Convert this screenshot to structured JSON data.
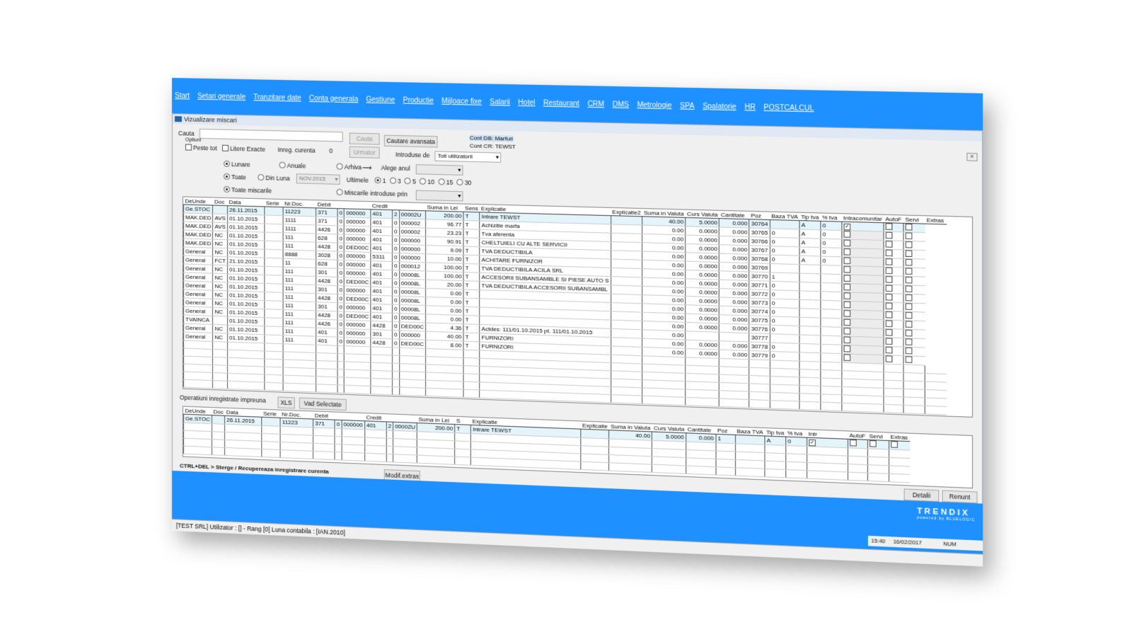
{
  "menu": [
    "Start",
    "Setari generale",
    "Tranzitare date",
    "Conta generala",
    "Gestiune",
    "Productie",
    "Mijloace fixe",
    "Salarii",
    "Hotel",
    "Restaurant",
    "CRM",
    "DMS",
    "Metrologie",
    "SPA",
    "Spalatorie",
    "HR",
    "POSTCALCUL"
  ],
  "window": {
    "title": "Vizualizare miscari"
  },
  "search": {
    "cauta_label": "Cauta",
    "cauta_btn": "Cauta",
    "advanced_btn": "Cautare avansata",
    "next_btn": "Urmator",
    "optiuni_label": "Optiuni",
    "peste_tot": "Peste tot",
    "litere_exacte": "Litere Exacte",
    "inreg_curenta_label": "Inreg. curenta",
    "inreg_curenta_value": "0",
    "introduse_de_label": "Introduse de",
    "introduse_de_value": "Toti utilizatorii",
    "cont_db": "Cont DB: Marfuri",
    "cont_cr": "Cont CR: TEWST"
  },
  "filters": {
    "lunare": "Lunare",
    "anuale": "Anuale",
    "arhiva": "Arhiva",
    "alege_anul": "Alege anul",
    "toate": "Toate",
    "din_luna": "Din Luna",
    "luna_value": "NOV.2015",
    "ultimele": "Ultimele",
    "ultimele_options": [
      "1",
      "3",
      "5",
      "10",
      "15",
      "30"
    ],
    "toate_miscarile": "Toate miscarile",
    "miscarile_introduse_prin": "Miscarile introduse prin"
  },
  "main_grid": {
    "columns": [
      "DeUnde",
      "Doc",
      "Data",
      "Serie",
      "Nr.Doc.",
      "Debit",
      "",
      "",
      "Credit",
      "",
      "",
      "Suma in Lei",
      "Sens",
      "Explicatie",
      "Explicatie2",
      "Suma in Valuta",
      "Curs Valuta",
      "Cantitate",
      "Poz",
      "Baza TVA",
      "Tip tva",
      "% tva",
      "Intracomunitar",
      "AutoF",
      "Servi",
      "Extras"
    ],
    "rows": [
      [
        "Ge.STOC",
        "",
        "26.11.2015",
        "",
        "11223",
        "371",
        "0",
        "000000",
        "401",
        "2",
        "00002U",
        "200.00",
        "T",
        "Intrare TEWST",
        "",
        "40.00",
        "5.0000",
        "0.000",
        "30764",
        "",
        "A",
        "0",
        "x",
        "",
        ""
      ],
      [
        "MAK.DED",
        "AVS",
        "01.10.2015",
        "",
        "1111",
        "371",
        "0",
        "000000",
        "401",
        "0",
        "000002",
        "96.77",
        "T",
        "Achizitie marfa",
        "",
        "0.00",
        "0.0000",
        "0.000",
        "30765",
        "0",
        "A",
        "0",
        "",
        "",
        ""
      ],
      [
        "MAK.DED",
        "AVS",
        "01.10.2015",
        "",
        "1111",
        "4426",
        "0",
        "000000",
        "401",
        "0",
        "000002",
        "23.23",
        "T",
        "Tva aferenta",
        "",
        "0.00",
        "0.0000",
        "0.000",
        "30766",
        "0",
        "A",
        "0",
        "",
        "",
        ""
      ],
      [
        "MAK.DED",
        "NC",
        "01.10.2015",
        "",
        "111",
        "628",
        "0",
        "000000",
        "401",
        "0",
        "000000",
        "90.91",
        "T",
        "CHELTUIELI CU ALTE SERVICII",
        "",
        "0.00",
        "0.0000",
        "0.000",
        "30767",
        "0",
        "A",
        "0",
        "",
        "",
        ""
      ],
      [
        "MAK.DED",
        "NC",
        "01.10.2015",
        "",
        "111",
        "4428",
        "0",
        "DED00C",
        "401",
        "0",
        "000000",
        "9.09",
        "T",
        "TVA DEDUCTIBILA",
        "",
        "0.00",
        "0.0000",
        "0.000",
        "30768",
        "0",
        "A",
        "0",
        "",
        "",
        ""
      ],
      [
        "General",
        "NC",
        "01.10.2015",
        "",
        "8888",
        "3028",
        "0",
        "000000",
        "5311",
        "0",
        "000000",
        "10.00",
        "T",
        "ACHITARE FURNIZOR",
        "",
        "0.00",
        "0.0000",
        "0.000",
        "30769",
        "",
        "",
        "",
        "",
        "",
        ""
      ],
      [
        "General",
        "FCT",
        "21.10.2015",
        "",
        "11",
        "628",
        "0",
        "000000",
        "401",
        "0",
        "000012",
        "100.00",
        "T",
        "TVA DEDUCTIBILA ACILA SRL",
        "",
        "0.00",
        "0.0000",
        "0.000",
        "30770",
        "1",
        "",
        "",
        "",
        "",
        ""
      ],
      [
        "General",
        "NC",
        "01.10.2015",
        "",
        "111",
        "301",
        "0",
        "000000",
        "401",
        "0",
        "00008L",
        "100.00",
        "T",
        "ACCESORII SUBANSAMBLE SI PIESE AUTO S",
        "",
        "0.00",
        "0.0000",
        "0.000",
        "30771",
        "0",
        "",
        "",
        "",
        "",
        ""
      ],
      [
        "General",
        "NC",
        "01.10.2015",
        "",
        "111",
        "4428",
        "0",
        "DED00C",
        "401",
        "0",
        "00008L",
        "20.00",
        "T",
        "TVA DEDUCTIBILA ACCESORII SUBANSAMBL",
        "",
        "0.00",
        "0.0000",
        "0.000",
        "30772",
        "0",
        "",
        "",
        "",
        "",
        ""
      ],
      [
        "General",
        "NC",
        "01.10.2015",
        "",
        "111",
        "301",
        "0",
        "000000",
        "401",
        "0",
        "00008L",
        "0.00",
        "T",
        "",
        "",
        "0.00",
        "0.0000",
        "0.000",
        "30773",
        "0",
        "",
        "",
        "",
        "",
        ""
      ],
      [
        "General",
        "NC",
        "01.10.2015",
        "",
        "111",
        "4428",
        "0",
        "DED00C",
        "401",
        "0",
        "00008L",
        "0.00",
        "T",
        "",
        "",
        "0.00",
        "0.0000",
        "0.000",
        "30774",
        "0",
        "",
        "",
        "",
        "",
        ""
      ],
      [
        "General",
        "NC",
        "01.10.2015",
        "",
        "111",
        "301",
        "0",
        "000000",
        "401",
        "0",
        "00008L",
        "0.00",
        "T",
        "",
        "",
        "0.00",
        "0.0000",
        "0.000",
        "30775",
        "0",
        "",
        "",
        "",
        "",
        ""
      ],
      [
        "General",
        "NC",
        "01.10.2015",
        "",
        "111",
        "4428",
        "0",
        "DED00C",
        "401",
        "0",
        "00008L",
        "0.00",
        "T",
        "",
        "",
        "0.00",
        "0.0000",
        "0.000",
        "30776",
        "0",
        "",
        "",
        "",
        "",
        ""
      ],
      [
        "TVAINCA",
        "",
        "01.10.2015",
        "",
        "111",
        "4426",
        "0",
        "000000",
        "4428",
        "0",
        "DED00C",
        "4.36",
        "T",
        "Actdes: 111/01.10.2015 pt. 111/01.10.2015",
        "",
        "0.00",
        "",
        "",
        "30777",
        "",
        "",
        "",
        "",
        "",
        ""
      ],
      [
        "General",
        "NC",
        "01.10.2015",
        "",
        "111",
        "401",
        "0",
        "000000",
        "301",
        "0",
        "000000",
        "40.00",
        "T",
        "FURNIZORI",
        "",
        "0.00",
        "0.0000",
        "0.000",
        "30778",
        "0",
        "",
        "",
        "",
        "",
        ""
      ],
      [
        "General",
        "NC",
        "01.10.2015",
        "",
        "111",
        "401",
        "0",
        "000000",
        "4428",
        "0",
        "DED00C",
        "8.00",
        "T",
        "FURNIZORI",
        "",
        "0.00",
        "0.0000",
        "0.000",
        "30779",
        "0",
        "",
        "",
        "",
        "",
        ""
      ]
    ]
  },
  "bottom": {
    "tab_label": "Operatiuni inregistrate impreuna",
    "xls_btn": "XLS",
    "vad_selectate_btn": "Vad Selectate",
    "columns": [
      "DeUnde",
      "Doc",
      "Data",
      "Serie",
      "Nr.Doc.",
      "Debit",
      "",
      "",
      "Credit",
      "",
      "",
      "Suma in Lei",
      "S",
      "Explicatie",
      "Explicatie",
      "Suma in Valuta",
      "Curs Valuta",
      "Cantitate",
      "Poz",
      "Baza TVA",
      "Tip tva",
      "% tva",
      "Intr",
      "AutoF",
      "Servi",
      "Extras"
    ],
    "rows": [
      [
        "Ge.STOC",
        "",
        "26.11.2015",
        "",
        "11223",
        "371",
        "0",
        "000000",
        "401",
        "2",
        "00002U",
        "200.00",
        "T",
        "Intrare TEWST",
        "",
        "40.00",
        "5.0000",
        "0.000",
        "1",
        "",
        "A",
        "0",
        "x",
        "",
        "",
        ""
      ]
    ]
  },
  "actions": {
    "hint": "CTRL+DEL > Sterge / Recupereaza inregistrare curenta",
    "modif_extras": "Modif.extras",
    "detalii": "Detalii",
    "renunt": "Renunt"
  },
  "footer": {
    "logo": "TRENDIX",
    "powered": "powered by BLUELOGIC",
    "time": "15:40",
    "date": "16/02/2017",
    "num": "NUM",
    "status": "[TEST SRL]  Utilizator : []  - Rang [0]  Luna contabila : [IAN.2010]"
  }
}
